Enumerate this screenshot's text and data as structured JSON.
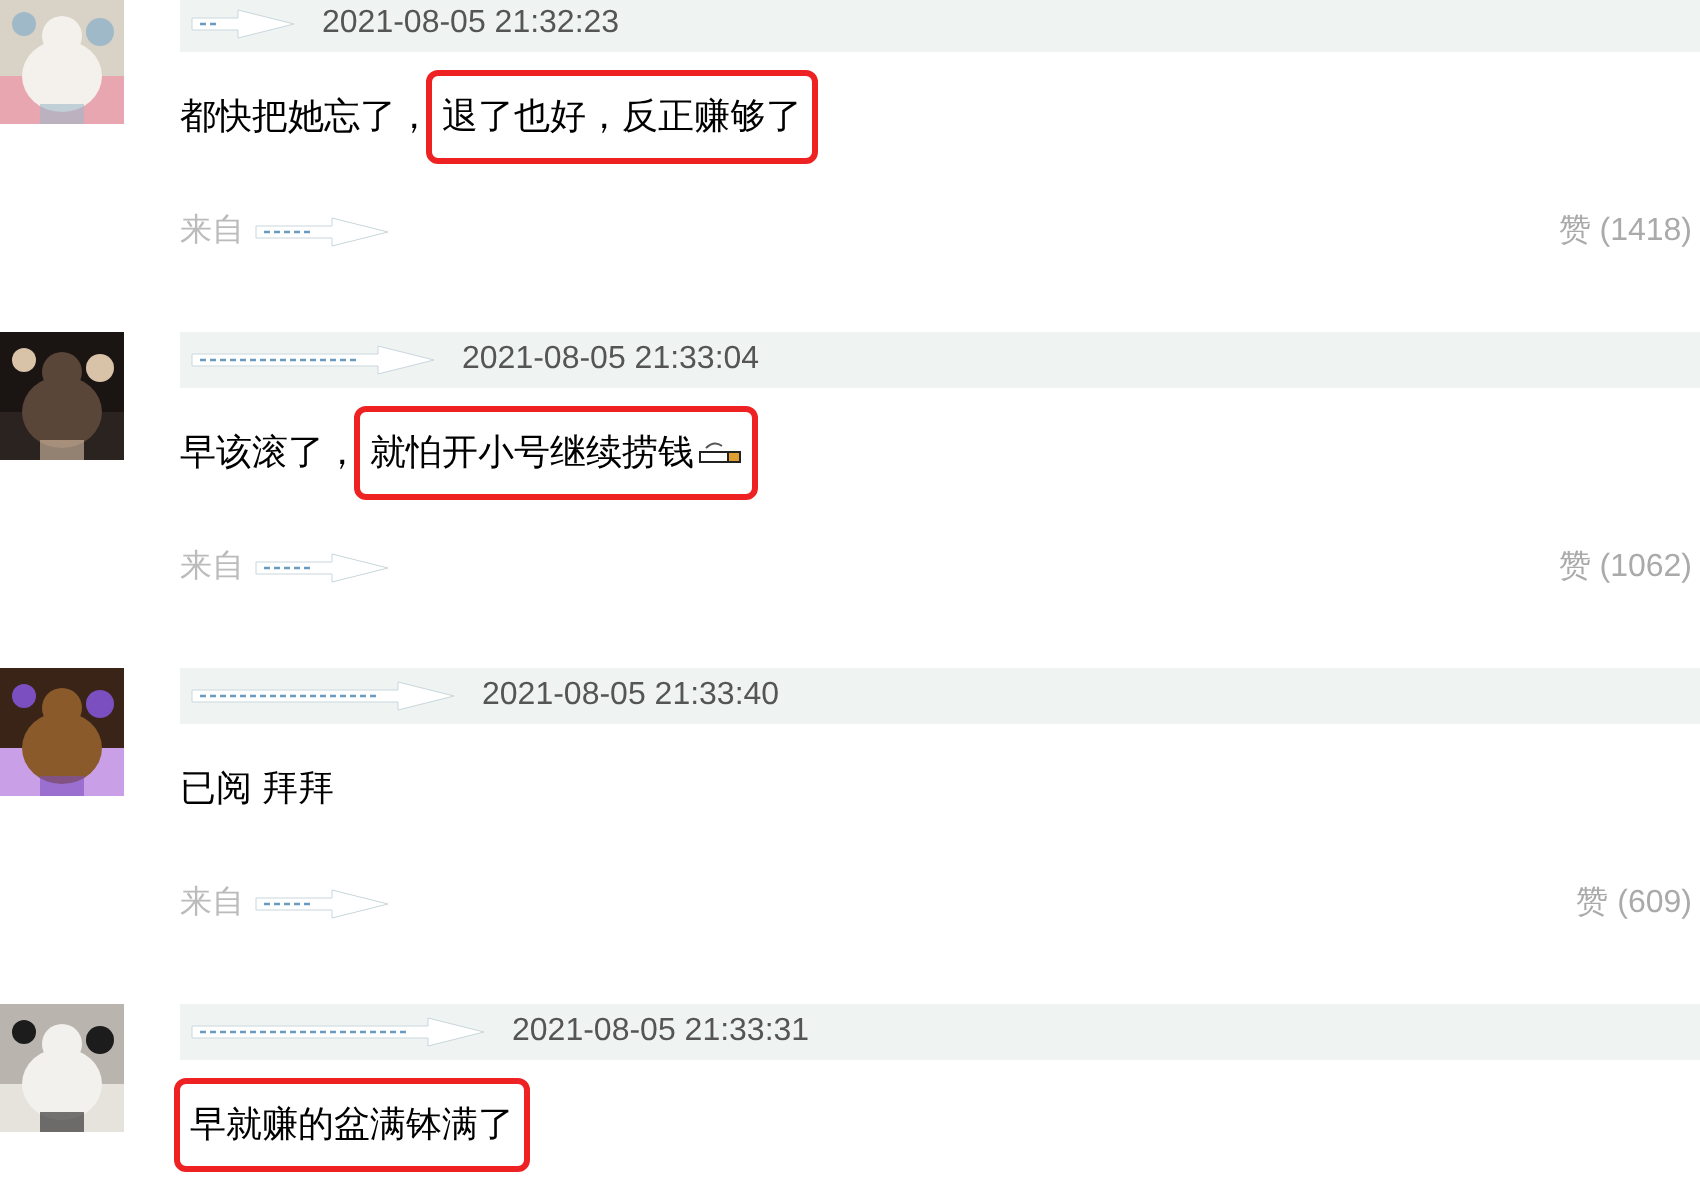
{
  "comments": [
    {
      "avatar": {
        "kind": "picture"
      },
      "time": "2021-08-05 21:32:23",
      "segments": [
        {
          "text": "都快把她忘了，",
          "highlighted": false,
          "kind": "plain"
        },
        {
          "text": "退了也好，反正赚够了",
          "highlighted": true,
          "kind": "plain"
        }
      ],
      "source": "来自",
      "likes": "赞 (1418)"
    },
    {
      "avatar": {
        "kind": "picture"
      },
      "time": "2021-08-05 21:33:04",
      "segments": [
        {
          "text": "早该滚了，",
          "highlighted": false,
          "kind": "plain"
        },
        {
          "text": "就怕开小号继续捞钱",
          "highlighted": true,
          "kind": "cigarette"
        }
      ],
      "source": "来自",
      "likes": "赞 (1062)"
    },
    {
      "avatar": {
        "kind": "picture"
      },
      "time": "2021-08-05 21:33:40",
      "segments": [
        {
          "text": "已阅 拜拜",
          "highlighted": false,
          "kind": "plain"
        }
      ],
      "source": "来自",
      "likes": "赞 (609)"
    },
    {
      "avatar": {
        "kind": "picture"
      },
      "time": "2021-08-05 21:33:31",
      "segments": [
        {
          "text": "早就赚的盆满钵满了",
          "highlighted": true,
          "kind": "plain"
        }
      ]
    }
  ]
}
